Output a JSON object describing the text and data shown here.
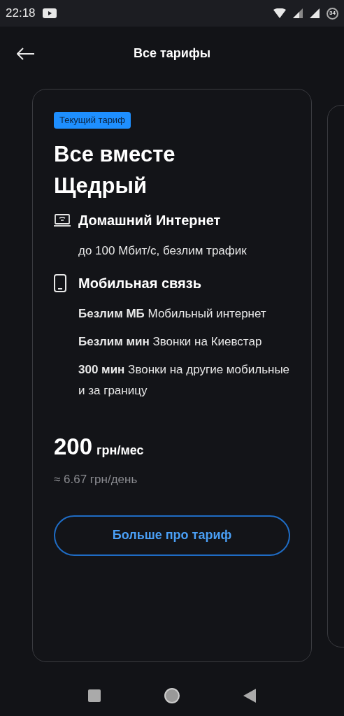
{
  "status_bar": {
    "time": "22:18",
    "battery": "34"
  },
  "header": {
    "title": "Все тарифы"
  },
  "card": {
    "badge": "Текущий тариф",
    "title": "Все вместе Щедрый",
    "sections": [
      {
        "kind": "internet",
        "title": "Домашний Интернет",
        "items": [
          "до 100 Мбит/с, безлим трафик"
        ]
      },
      {
        "kind": "mobile",
        "title": "Мобильная связь",
        "items": [
          "**Безлим МБ** Мобильный интернет",
          "**Безлим мин** Звонки на Киевстар",
          "**300 мин** Звонки на другие мобильные и за границу"
        ]
      }
    ],
    "price": "200",
    "price_unit": "грн/мес",
    "per_day": "≈ 6.67 грн/день",
    "button": "Больше про тариф"
  }
}
